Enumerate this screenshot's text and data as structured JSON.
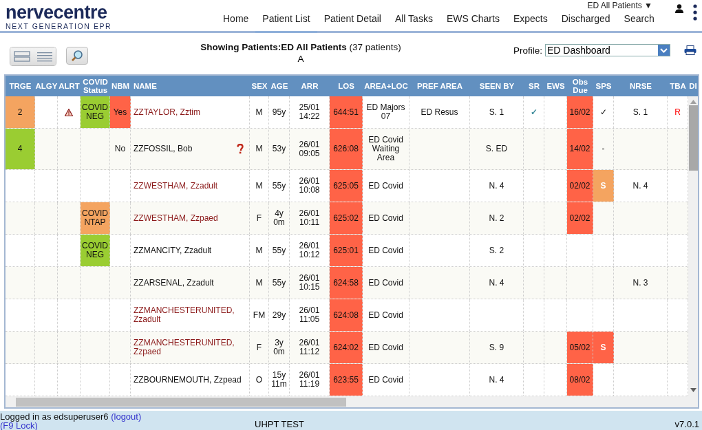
{
  "logo": {
    "name": "nervecentre",
    "tagline": "NEXT GENERATION EPR"
  },
  "nav": [
    {
      "label": "Home",
      "selected": false
    },
    {
      "label": "Patient List",
      "selected": true
    },
    {
      "label": "Patient Detail",
      "selected": false
    },
    {
      "label": "All Tasks",
      "selected": false
    },
    {
      "label": "EWS Charts",
      "selected": false
    },
    {
      "label": "Expects",
      "selected": false
    },
    {
      "label": "Discharged",
      "selected": false
    },
    {
      "label": "Search",
      "selected": false
    }
  ],
  "list_selector": "ED All Patients ▼",
  "toolbar": {
    "heading": "**Showing Patients:ED All Patients** (37 patients)",
    "letter": "A",
    "profile_label": "Profile:",
    "profile_value": "ED Dashboard"
  },
  "table": {
    "columns": [
      "TRGE",
      "ALGY",
      "ALRT",
      "COVID Status",
      "NBM",
      "NAME",
      "SEX",
      "AGE",
      "ARR",
      "LOS",
      "AREA+LOC",
      "PREF AREA",
      "SEEN BY",
      "SR",
      "EWS",
      "Obs Due",
      "SPS",
      "NRSE",
      "TBA",
      "DI"
    ],
    "rows": [
      {
        "cells": [
          {
            "text": "2",
            "color": "#f4a460"
          },
          null,
          {
            "kind": "warning"
          },
          {
            "text": "COVID NEG",
            "color": "#9acd32"
          },
          {
            "text": "Yes",
            "color": "#ff6347"
          },
          {
            "text": "ZZTAYLOR, Zztim",
            "kind": "colored_text",
            "color": "#8b1a1a"
          },
          {
            "text": "M"
          },
          {
            "text": "95y"
          },
          {
            "text": "25/01 14:22"
          },
          {
            "text": "644:51",
            "color": "#ff6347"
          },
          {
            "text": "ED Majors 07"
          },
          {
            "text": "ED Resus"
          },
          {
            "text": "S. 1"
          },
          {
            "text": "✓",
            "kind": "colored_text",
            "color": "#3a8a9a"
          },
          null,
          {
            "text": "16/02",
            "color": "#ff6347"
          },
          {
            "text": "✓"
          },
          {
            "text": "S. 1"
          },
          {
            "text": "R",
            "kind": "colored_text",
            "color": "#ff0000"
          }
        ]
      },
      {
        "cells": [
          {
            "text": "4",
            "color": "#9acd32"
          },
          null,
          null,
          null,
          {
            "text": "No"
          },
          {
            "text": "ZZFOSSIL, Bob",
            "kind": "query"
          },
          {
            "text": "M"
          },
          {
            "text": "53y"
          },
          {
            "text": "26/01 09:05"
          },
          {
            "text": "626:08",
            "color": "#ff6347"
          },
          {
            "text": "ED Covid Waiting Area"
          },
          null,
          {
            "text": "S. ED"
          },
          null,
          null,
          {
            "text": "14/02",
            "color": "#ff6347"
          },
          {
            "text": "-"
          },
          null,
          null
        ]
      },
      {
        "cells": [
          null,
          null,
          null,
          null,
          null,
          {
            "text": "ZZWESTHAM, Zzadult",
            "kind": "colored_text",
            "color": "#8b1a1a"
          },
          {
            "text": "M"
          },
          {
            "text": "55y"
          },
          {
            "text": "26/01 10:08"
          },
          {
            "text": "625:05",
            "color": "#ff6347"
          },
          {
            "text": "ED Covid"
          },
          null,
          {
            "text": "N. 4"
          },
          null,
          null,
          {
            "text": "02/02",
            "color": "#ff6347"
          },
          {
            "text": "S",
            "kind": "badge",
            "color": "#f4a460"
          },
          {
            "text": "N. 4"
          },
          null
        ]
      },
      {
        "cells": [
          null,
          null,
          null,
          {
            "text": "COVID NTAP",
            "color": "#f4a460"
          },
          null,
          {
            "text": "ZZWESTHAM, Zzpaed",
            "kind": "colored_text",
            "color": "#8b1a1a"
          },
          {
            "text": "F"
          },
          {
            "text": "4y 0m"
          },
          {
            "text": "26/01 10:11"
          },
          {
            "text": "625:02",
            "color": "#ff6347"
          },
          {
            "text": "ED Covid"
          },
          null,
          {
            "text": "N. 2"
          },
          null,
          null,
          {
            "text": "02/02",
            "color": "#ff6347"
          },
          null,
          null,
          null
        ]
      },
      {
        "cells": [
          null,
          null,
          null,
          {
            "text": "COVID NEG",
            "color": "#9acd32"
          },
          null,
          {
            "text": "ZZMANCITY, Zzadult"
          },
          {
            "text": "M"
          },
          {
            "text": "55y"
          },
          {
            "text": "26/01 10:12"
          },
          {
            "text": "625:01",
            "color": "#ff6347"
          },
          {
            "text": "ED Covid"
          },
          null,
          {
            "text": "S. 2"
          },
          null,
          null,
          null,
          null,
          null,
          null
        ]
      },
      {
        "cells": [
          null,
          null,
          null,
          null,
          null,
          {
            "text": "ZZARSENAL, Zzadult"
          },
          {
            "text": "M"
          },
          {
            "text": "55y"
          },
          {
            "text": "26/01 10:15"
          },
          {
            "text": "624:58",
            "color": "#ff6347"
          },
          {
            "text": "ED Covid"
          },
          null,
          {
            "text": "N. 4"
          },
          null,
          null,
          null,
          null,
          {
            "text": "N. 3"
          },
          null
        ]
      },
      {
        "cells": [
          null,
          null,
          null,
          null,
          null,
          {
            "text": "ZZMANCHESTERUNITED, Zzadult",
            "kind": "colored_text",
            "color": "#8b1a1a"
          },
          {
            "text": "FM"
          },
          {
            "text": "29y"
          },
          {
            "text": "26/01 11:05"
          },
          {
            "text": "624:08",
            "color": "#ff6347"
          },
          {
            "text": "ED Covid"
          },
          null,
          null,
          null,
          null,
          null,
          null,
          null,
          null
        ]
      },
      {
        "cells": [
          null,
          null,
          null,
          null,
          null,
          {
            "text": "ZZMANCHESTERUNITED, Zzpaed",
            "kind": "colored_text",
            "color": "#8b1a1a"
          },
          {
            "text": "F"
          },
          {
            "text": "3y 0m"
          },
          {
            "text": "26/01 11:12"
          },
          {
            "text": "624:02",
            "color": "#ff6347"
          },
          {
            "text": "ED Covid"
          },
          null,
          {
            "text": "S. 9"
          },
          null,
          null,
          {
            "text": "05/02",
            "color": "#ff6347"
          },
          {
            "text": "S",
            "kind": "badge",
            "color": "#ff6347"
          },
          null,
          null
        ]
      },
      {
        "cells": [
          null,
          null,
          null,
          null,
          null,
          {
            "text": "ZZBOURNEMOUTH, Zzpead"
          },
          {
            "text": "O"
          },
          {
            "text": "15y 11m"
          },
          {
            "text": "26/01 11:19"
          },
          {
            "text": "623:55",
            "color": "#ff6347"
          },
          {
            "text": "ED Covid"
          },
          null,
          {
            "text": "N. 4"
          },
          null,
          null,
          {
            "text": "08/02",
            "color": "#ff6347"
          },
          null,
          null,
          null
        ]
      }
    ]
  },
  "status_bar": {
    "user_text": "Logged in as edsuperuser6",
    "logout": "(logout)",
    "lock": "(F9 Lock)",
    "environment": "UHPT TEST",
    "version": "v7.0.1"
  }
}
